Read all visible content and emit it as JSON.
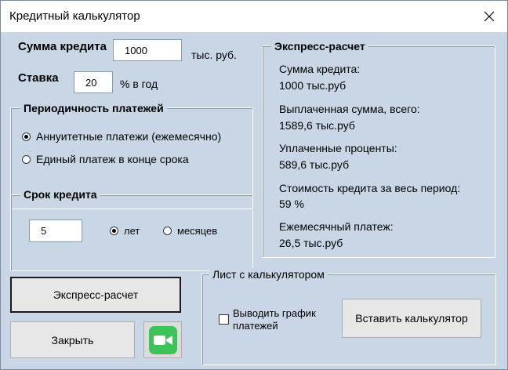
{
  "window": {
    "title": "Кредитный калькулятор"
  },
  "loan": {
    "amount_label": "Сумма кредита",
    "amount_value": "1000",
    "amount_unit": "тыс. руб.",
    "rate_label": "Ставка",
    "rate_value": "20",
    "rate_unit": "%  в год"
  },
  "periodicity": {
    "legend": "Периодичность платежей",
    "options": [
      {
        "label": "Аннуитетные платежи (ежемесячно)",
        "selected": true
      },
      {
        "label": "Единый платеж в конце срока",
        "selected": false
      }
    ]
  },
  "term": {
    "legend": "Срок кредита",
    "value": "5",
    "options": [
      {
        "label": "лет",
        "selected": true
      },
      {
        "label": "месяцев",
        "selected": false
      }
    ]
  },
  "express": {
    "legend": "Экспресс-расчет",
    "lines": [
      "Сумма кредита:",
      "1000 тыс.руб",
      "Выплаченная сумма, всего:",
      "1589,6 тыс.руб",
      "Уплаченные проценты:",
      "589,6 тыс.руб",
      "Стоимость кредита за весь период:",
      "59 %",
      "Ежемесячный платеж:",
      "26,5 тыс.руб"
    ]
  },
  "sheet": {
    "legend": "Лист с калькулятором",
    "checkbox_label_1": "Выводить график",
    "checkbox_label_2": "платежей",
    "checkbox_checked": false,
    "insert_button": "Вставить калькулятор"
  },
  "buttons": {
    "express": "Экспресс-расчет",
    "close": "Закрыть",
    "video_icon": "video-camera-icon"
  },
  "colors": {
    "background": "#c8d6e5",
    "video_button": "#3cc45a"
  }
}
